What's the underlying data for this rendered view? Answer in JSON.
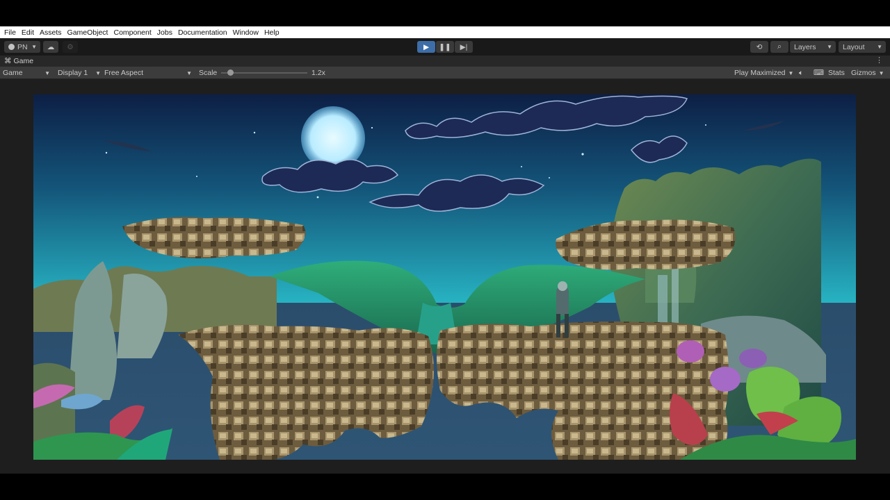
{
  "menu": [
    "File",
    "Edit",
    "Assets",
    "GameObject",
    "Component",
    "Jobs",
    "Documentation",
    "Window",
    "Help"
  ],
  "toolbar": {
    "account_label": "PN",
    "layers_label": "Layers",
    "layout_label": "Layout"
  },
  "tab": {
    "label": "Game"
  },
  "controls": {
    "view_mode": "Game",
    "display": "Display 1",
    "aspect": "Free Aspect",
    "scale_label": "Scale",
    "scale_value": "1.2x",
    "play_mode": "Play Maximized",
    "stats": "Stats",
    "gizmos": "Gizmos"
  },
  "colors": {
    "menubar": "#ffffff",
    "toolbar": "#191919",
    "play_active": "#3d6ea8",
    "sky_top": "#0d1f45",
    "sky_bottom": "#27b3c2",
    "water": "#2e4f6b"
  }
}
